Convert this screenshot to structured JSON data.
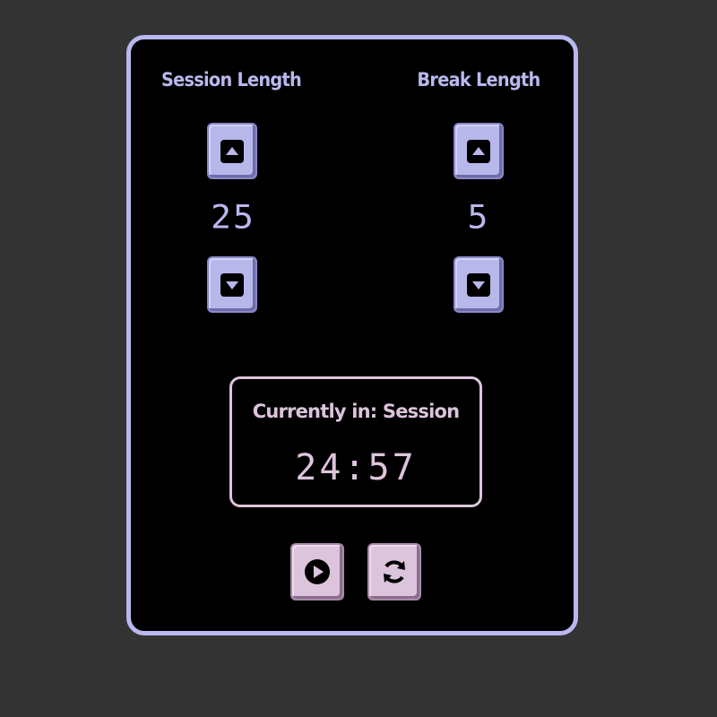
{
  "session": {
    "title": "Session Length",
    "value": "25"
  },
  "break": {
    "title": "Break Length",
    "value": "5"
  },
  "status": {
    "label": "Currently in: Session",
    "time": "24:57"
  },
  "controls": {
    "increment_icon": "caret-up-icon",
    "decrement_icon": "caret-down-icon",
    "play_icon": "play-circle-icon",
    "reset_icon": "refresh-icon"
  },
  "colors": {
    "background": "#333333",
    "card": "#000000",
    "accent_blue": "#b9b8ee",
    "accent_pink": "#dcc4dc"
  }
}
